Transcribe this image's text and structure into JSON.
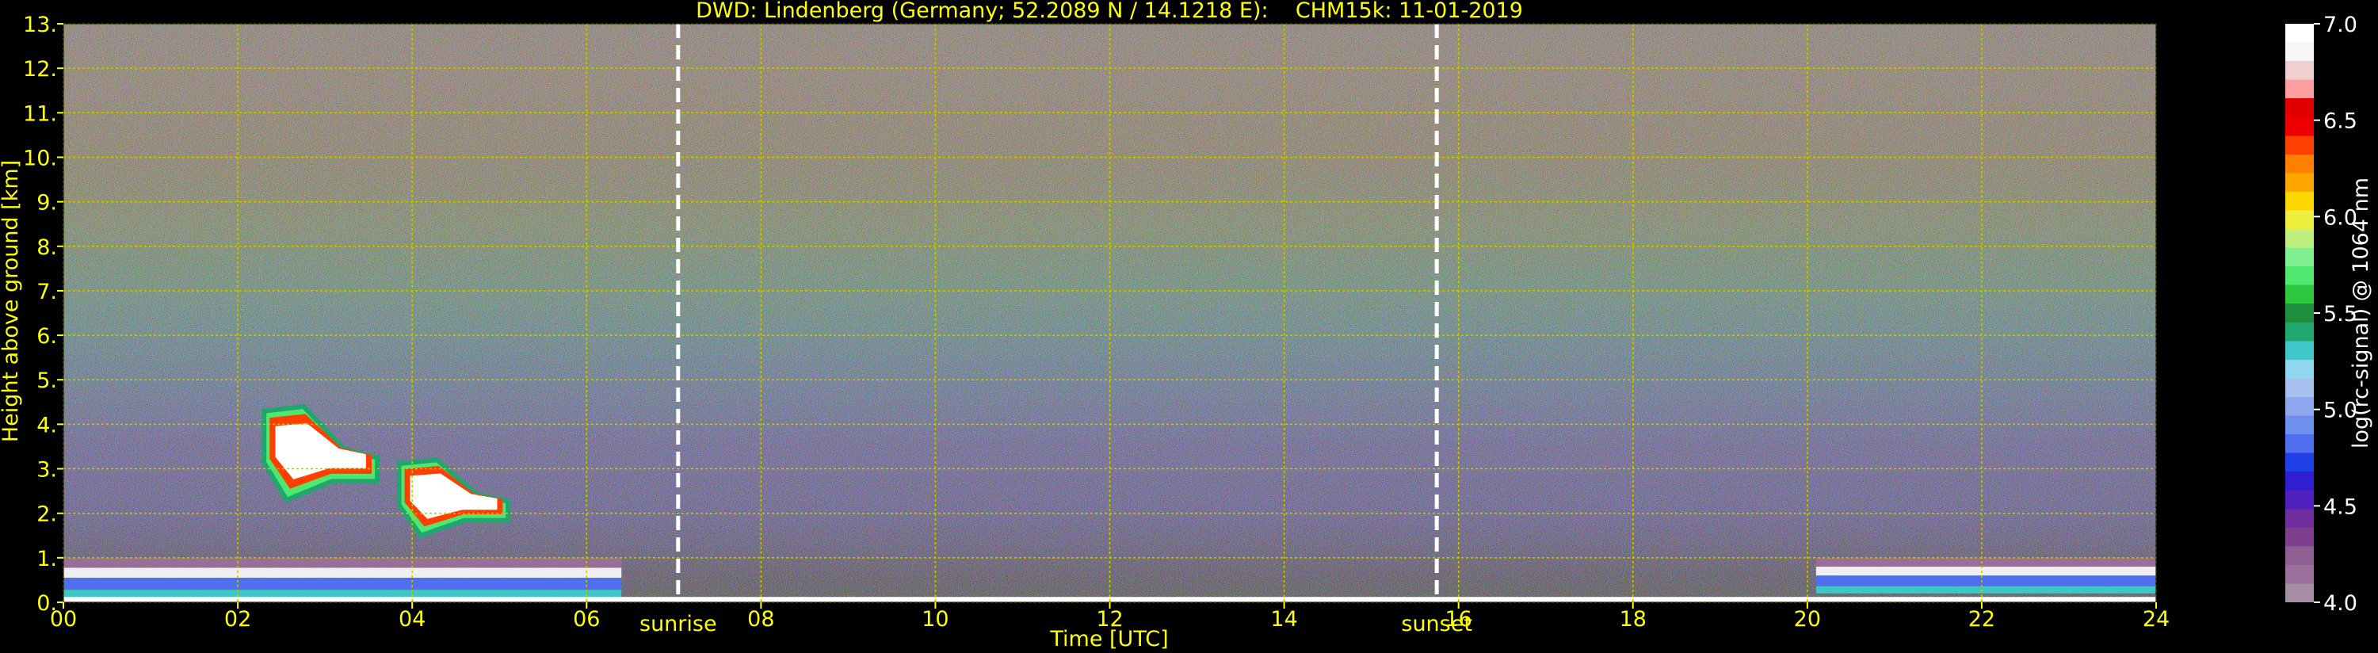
{
  "chart_data": {
    "type": "heatmap",
    "title": "DWD: Lindenberg (Germany; 52.2089 N / 14.1218 E):    CHM15k: 11-01-2019",
    "xlabel": "Time [UTC]",
    "ylabel": "Height above ground [km]",
    "xlim": [
      0,
      24
    ],
    "ylim": [
      0,
      13
    ],
    "x_ticks": [
      "00",
      "02",
      "04",
      "06",
      "08",
      "10",
      "12",
      "14",
      "16",
      "18",
      "20",
      "22",
      "24"
    ],
    "y_ticks": [
      "0.",
      "1.",
      "2.",
      "3.",
      "4.",
      "5.",
      "6.",
      "7.",
      "8.",
      "9.",
      "10.",
      "11.",
      "12.",
      "13."
    ],
    "grid": true,
    "annotations": [
      {
        "label": "sunrise",
        "time": 7.05
      },
      {
        "label": "sunset",
        "time": 15.75
      }
    ],
    "colorbar": {
      "label": "log(rc-signal) @ 1064 nm",
      "range": [
        4.0,
        7.0
      ],
      "ticks": [
        "4.0",
        "4.5",
        "5.0",
        "5.5",
        "6.0",
        "6.5",
        "7.0"
      ],
      "colors": [
        "#a58ea5",
        "#9d6f9d",
        "#8f5f93",
        "#7f3f8f",
        "#6f2f9f",
        "#4f1fc0",
        "#2f1fd0",
        "#1f3fe8",
        "#4f6fef",
        "#6f8fef",
        "#8fa7ef",
        "#a7c0f0",
        "#8fd7ef",
        "#3fc7c7",
        "#1fa76f",
        "#1f8f3f",
        "#2fc73f",
        "#4fe76f",
        "#7fef8f",
        "#bff07f",
        "#efef3f",
        "#ffd700",
        "#ffa500",
        "#ff7f00",
        "#ff3f00",
        "#ef0000",
        "#e00000",
        "#ff9f9f",
        "#efcfcf",
        "#f7f7f7",
        "#ffffff"
      ]
    },
    "features": [
      {
        "name": "boundary layer aerosol",
        "start": 0.0,
        "end": 6.4,
        "base_km": 0.1,
        "top_km": 1.0
      },
      {
        "name": "cloud",
        "start": 2.3,
        "end": 3.6,
        "base_km": 2.3,
        "top_km": 4.4
      },
      {
        "name": "cloud",
        "start": 3.85,
        "end": 5.1,
        "base_km": 1.5,
        "top_km": 3.2
      },
      {
        "name": "boundary layer aerosol",
        "start": 20.1,
        "end": 24.0,
        "base_km": 0.2,
        "top_km": 1.0
      }
    ]
  }
}
